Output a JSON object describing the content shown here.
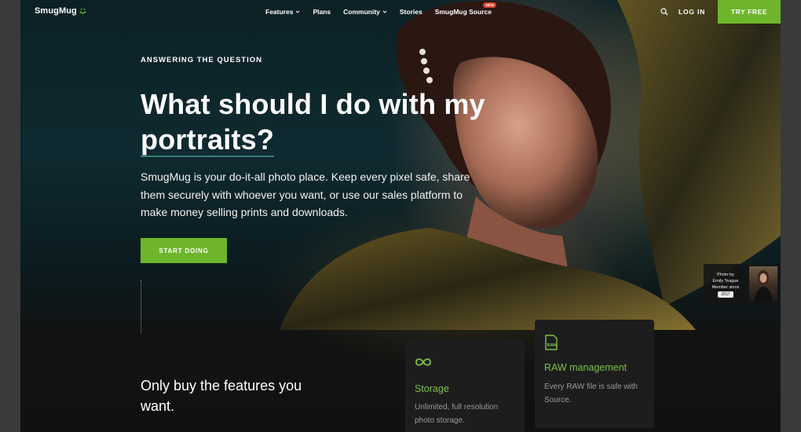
{
  "nav": {
    "logo_text": "SmugMug",
    "links": [
      {
        "label": "Features",
        "has_dropdown": true
      },
      {
        "label": "Plans",
        "has_dropdown": false
      },
      {
        "label": "Community",
        "has_dropdown": true
      },
      {
        "label": "Stories",
        "has_dropdown": false
      },
      {
        "label": "SmugMug Source",
        "has_dropdown": false,
        "badge": "NEW"
      }
    ],
    "search_icon": "search-icon",
    "login_label": "LOG IN",
    "cta_label": "TRY FREE"
  },
  "hero": {
    "eyebrow": "ANSWERING THE QUESTION",
    "headline_line1": "What should I do with my",
    "headline_line2": "portraits?",
    "subcopy": "SmugMug is your do-it-all photo place. Keep every pixel safe, share them securely with whoever you want, or use our sales platform to make money selling prints and downloads.",
    "cta_label": "START DOING"
  },
  "photo_credit": {
    "line1": "Photo by",
    "name": "Emily Teague",
    "line3": "Member since",
    "year": "2017"
  },
  "features": {
    "heading": "Only buy the features you want.",
    "cards": [
      {
        "icon": "infinity-icon",
        "title": "Storage",
        "description": "Unlimited, full resolution photo storage."
      },
      {
        "icon": "raw-file-icon",
        "title": "RAW management",
        "description": "Every RAW file is safe with Source."
      }
    ]
  },
  "colors": {
    "accent_green": "#6fb52c",
    "feature_title_green": "#7cc244",
    "hero_background": "#0e2a30",
    "card_background": "#1d1d1d"
  }
}
